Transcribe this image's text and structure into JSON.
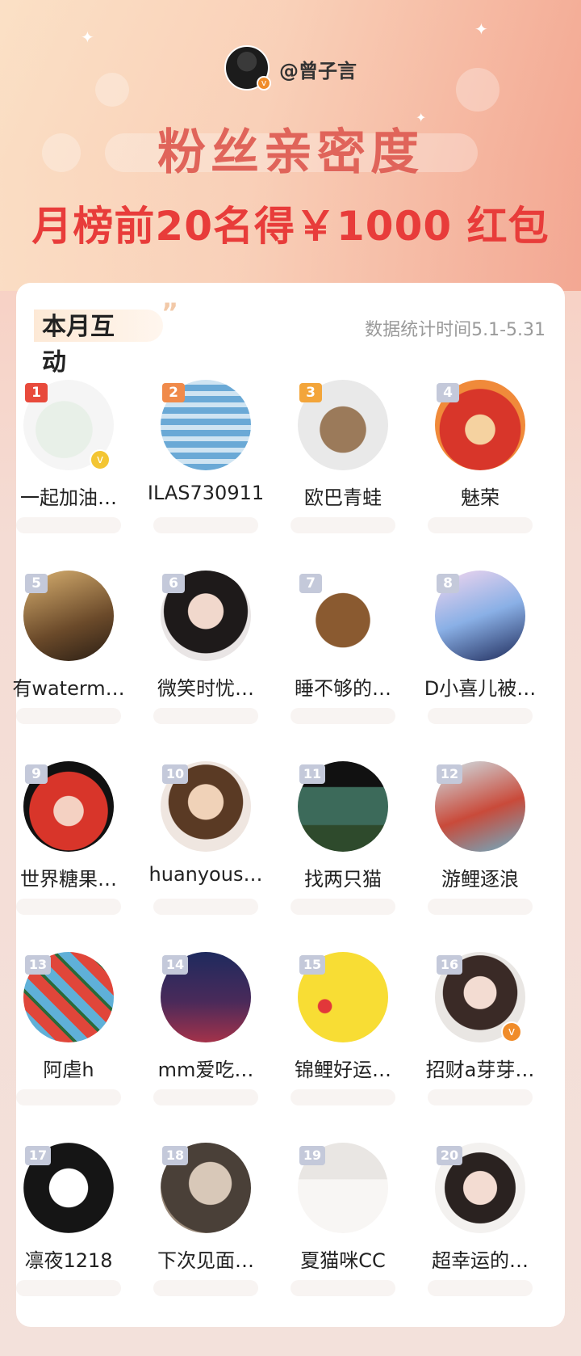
{
  "header": {
    "host_name": "@曾子言",
    "title": "粉丝亲密度",
    "subtitle": "月榜前20名得￥1000 红包"
  },
  "tab": {
    "label": "本月互动",
    "stat_time": "数据统计时间5.1-5.31"
  },
  "colors": {
    "title": "#e0645a",
    "subtitle": "#e83c3a",
    "rank_gold": "#e84a3c",
    "rank_silver": "#f08a4a",
    "rank_bronze": "#f3a53a",
    "rank_other": "#c4c9da",
    "verify_orange": "#f08c2a",
    "verify_yellow": "#f3c533"
  },
  "fans": [
    {
      "rank": "1",
      "name": "一起加油…",
      "verify": "yellow",
      "avatar": "quote-card-icon"
    },
    {
      "rank": "2",
      "name": "ILAS730911",
      "verify": "",
      "avatar": "child-photo-icon"
    },
    {
      "rank": "3",
      "name": "欧巴青蛙",
      "verify": "",
      "avatar": "capybara-cartoon-icon"
    },
    {
      "rank": "4",
      "name": "魅荣",
      "verify": "",
      "avatar": "anime-warrior-icon"
    },
    {
      "rank": "5",
      "name": "有waterm…",
      "verify": "",
      "avatar": "woman-photo-icon"
    },
    {
      "rank": "6",
      "name": "微笑时忧…",
      "verify": "",
      "avatar": "woman-covering-face-icon"
    },
    {
      "rank": "7",
      "name": "睡不够的…",
      "verify": "",
      "avatar": "puppy-icon"
    },
    {
      "rank": "8",
      "name": "D小喜儿被…",
      "verify": "",
      "avatar": "anime-moon-girl-icon"
    },
    {
      "rank": "9",
      "name": "世界糖果…",
      "verify": "",
      "avatar": "red-hair-girl-icon"
    },
    {
      "rank": "10",
      "name": "huanyous…",
      "verify": "",
      "avatar": "anime-boy-icon"
    },
    {
      "rank": "11",
      "name": "找两只猫",
      "verify": "",
      "avatar": "mountain-landscape-icon"
    },
    {
      "rank": "12",
      "name": "游鲤逐浪",
      "verify": "",
      "avatar": "wuxia-art-icon"
    },
    {
      "rank": "13",
      "name": "阿虐h",
      "verify": "",
      "avatar": "watermelon-icon"
    },
    {
      "rank": "14",
      "name": "mm爱吃…",
      "verify": "",
      "avatar": "starry-sky-icon"
    },
    {
      "rank": "15",
      "name": "锦鲤好运…",
      "verify": "",
      "avatar": "pikachu-icon"
    },
    {
      "rank": "16",
      "name": "招财a芽芽…",
      "verify": "orange",
      "avatar": "girl-portrait-icon"
    },
    {
      "rank": "17",
      "name": "凛夜1218",
      "verify": "",
      "avatar": "manga-girl-icon"
    },
    {
      "rank": "18",
      "name": "下次见面…",
      "verify": "",
      "avatar": "selfie-photo-icon"
    },
    {
      "rank": "19",
      "name": "夏猫咪CC",
      "verify": "",
      "avatar": "woman-white-shirt-icon"
    },
    {
      "rank": "20",
      "name": "超幸运的…",
      "verify": "",
      "avatar": "woman-glasses-icon"
    }
  ]
}
